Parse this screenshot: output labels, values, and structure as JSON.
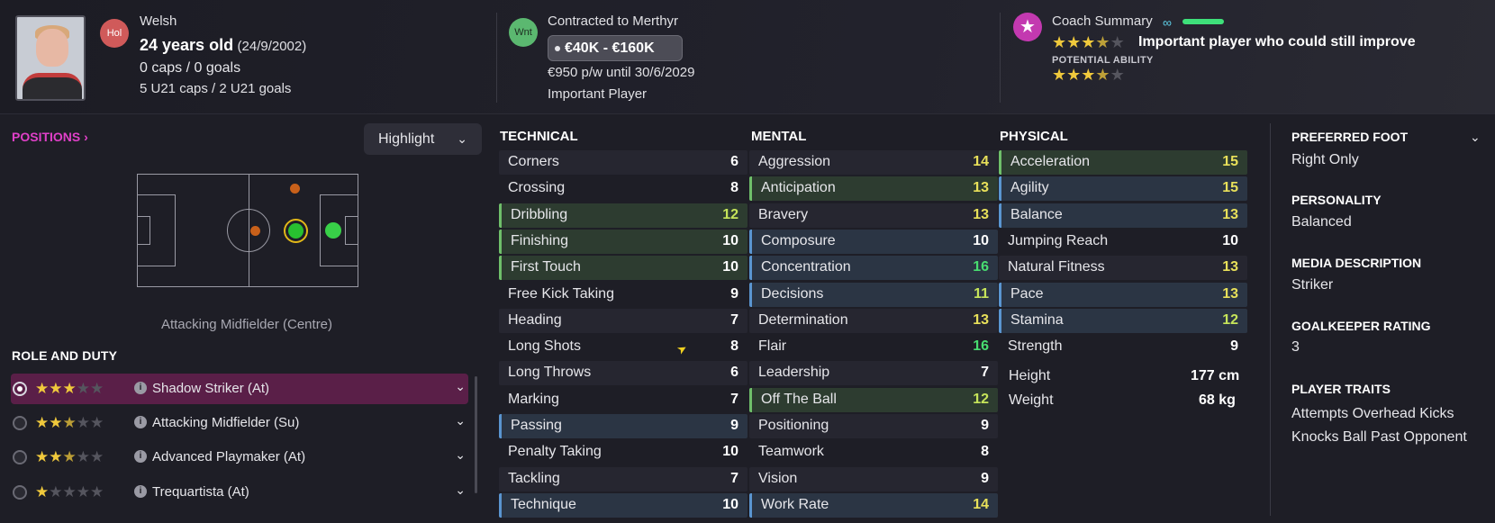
{
  "header": {
    "nationality": "Welsh",
    "hol_badge": "Hol",
    "age_main": "24 years old",
    "dob": "(24/9/2002)",
    "caps": "0 caps / 0 goals",
    "u21": "5 U21 caps / 2 U21 goals",
    "wnt_badge": "Wnt",
    "contract": "Contracted to Merthyr",
    "value_range": "€40K - €160K",
    "wage": "€950 p/w until 30/6/2029",
    "squad_status": "Important Player",
    "coach_summary_label": "Coach Summary",
    "coach_summary_text": "Important player who could still improve",
    "potential_label": "POTENTIAL ABILITY",
    "current_ability_stars": 3.5,
    "potential_ability_stars": 3.5
  },
  "left": {
    "positions_label": "POSITIONS ›",
    "highlight_label": "Highlight",
    "position_caption": "Attacking Midfielder (Centre)",
    "role_duty_label": "ROLE AND DUTY",
    "roles": [
      {
        "name": "Shadow Striker (At)",
        "stars": 3,
        "selected": true
      },
      {
        "name": "Attacking Midfielder (Su)",
        "stars": 2.5,
        "selected": false
      },
      {
        "name": "Advanced Playmaker (At)",
        "stars": 2.5,
        "selected": false
      },
      {
        "name": "Trequartista (At)",
        "stars": 1,
        "selected": false
      }
    ]
  },
  "attributes": {
    "technical_label": "TECHNICAL",
    "mental_label": "MENTAL",
    "physical_label": "PHYSICAL",
    "technical": [
      {
        "name": "Corners",
        "value": "6"
      },
      {
        "name": "Crossing",
        "value": "8"
      },
      {
        "name": "Dribbling",
        "value": "12"
      },
      {
        "name": "Finishing",
        "value": "10"
      },
      {
        "name": "First Touch",
        "value": "10"
      },
      {
        "name": "Free Kick Taking",
        "value": "9"
      },
      {
        "name": "Heading",
        "value": "7"
      },
      {
        "name": "Long Shots",
        "value": "8"
      },
      {
        "name": "Long Throws",
        "value": "6"
      },
      {
        "name": "Marking",
        "value": "7"
      },
      {
        "name": "Passing",
        "value": "9"
      },
      {
        "name": "Penalty Taking",
        "value": "10"
      },
      {
        "name": "Tackling",
        "value": "7"
      },
      {
        "name": "Technique",
        "value": "10"
      }
    ],
    "mental": [
      {
        "name": "Aggression",
        "value": "14"
      },
      {
        "name": "Anticipation",
        "value": "13"
      },
      {
        "name": "Bravery",
        "value": "13"
      },
      {
        "name": "Composure",
        "value": "10"
      },
      {
        "name": "Concentration",
        "value": "16"
      },
      {
        "name": "Decisions",
        "value": "11"
      },
      {
        "name": "Determination",
        "value": "13"
      },
      {
        "name": "Flair",
        "value": "16"
      },
      {
        "name": "Leadership",
        "value": "7"
      },
      {
        "name": "Off The Ball",
        "value": "12"
      },
      {
        "name": "Positioning",
        "value": "9"
      },
      {
        "name": "Teamwork",
        "value": "8"
      },
      {
        "name": "Vision",
        "value": "9"
      },
      {
        "name": "Work Rate",
        "value": "14"
      }
    ],
    "physical": [
      {
        "name": "Acceleration",
        "value": "15"
      },
      {
        "name": "Agility",
        "value": "15"
      },
      {
        "name": "Balance",
        "value": "13"
      },
      {
        "name": "Jumping Reach",
        "value": "10"
      },
      {
        "name": "Natural Fitness",
        "value": "13"
      },
      {
        "name": "Pace",
        "value": "13"
      },
      {
        "name": "Stamina",
        "value": "12"
      },
      {
        "name": "Strength",
        "value": "9"
      }
    ],
    "height_label": "Height",
    "height_value": "177 cm",
    "weight_label": "Weight",
    "weight_value": "68 kg"
  },
  "info": {
    "foot_label": "PREFERRED FOOT",
    "foot_value": "Right Only",
    "personality_label": "PERSONALITY",
    "personality_value": "Balanced",
    "media_label": "MEDIA DESCRIPTION",
    "media_value": "Striker",
    "gk_label": "GOALKEEPER RATING",
    "gk_value": "3",
    "traits_label": "PLAYER TRAITS",
    "traits": [
      "Attempts Overhead Kicks",
      "Knocks Ball Past Opponent"
    ]
  },
  "colors": {
    "accent_magenta": "#e040c8",
    "attr_white": "#ffffff",
    "attr_yellow": "#e8e05a",
    "attr_green": "#48dc70",
    "attr_lime": "#c6e45a"
  }
}
